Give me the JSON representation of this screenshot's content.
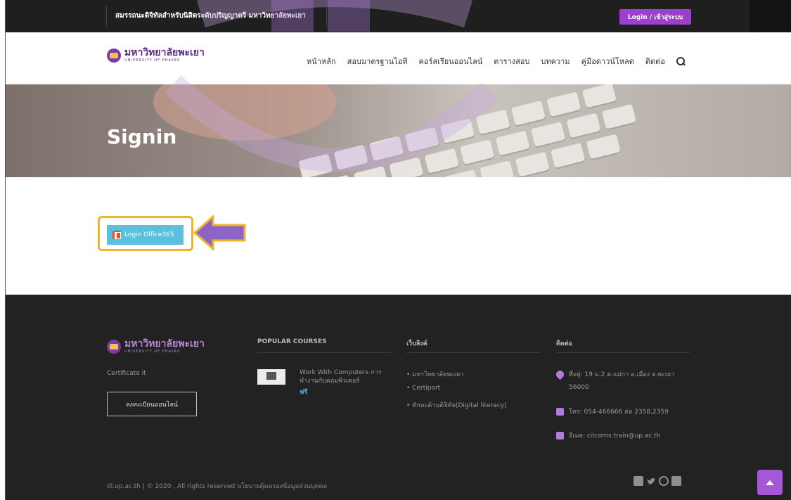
{
  "topbar": {
    "text": "สมรรถนะดิจิทัลสำหรับนิสิตระดับปริญญาตรี มหาวิทยาลัยพะเยา",
    "login_label": "Login / เข้าสู่ระบบ"
  },
  "brand": {
    "name_th": "มหาวิทยาลัยพะเยา",
    "name_en": "UNIVERSITY OF PHAYAO"
  },
  "nav": {
    "items": [
      {
        "label": "หน้าหลัก"
      },
      {
        "label": "สอบมาตรฐานไอที"
      },
      {
        "label": "คอร์สเรียนออนไลน์"
      },
      {
        "label": "ตารางสอบ"
      },
      {
        "label": "บทความ"
      },
      {
        "label": "คู่มือดาวน์โหลด"
      },
      {
        "label": "ติดต่อ"
      }
    ],
    "search_icon": "search-icon"
  },
  "banner": {
    "title": "Signin"
  },
  "content": {
    "office_button_label": "Login Office365",
    "highlight_color": "#f0b429",
    "arrow_color": "#8b64c6"
  },
  "footer": {
    "brand_name_th": "มหาวิทยาลัยพะเยา",
    "brand_name_en": "UNIVERSITY OF PHAYAO",
    "tagline": "Certificate it",
    "register_label": "ลงทะเบียนออนไลน์",
    "popular_title": "POPULAR COURSES",
    "course": {
      "title": "Work With Computers การทำงานกับคอมพิวเตอร์",
      "price": "ฟรี"
    },
    "links_title": "เว็บลิงค์",
    "links": [
      {
        "label": "• มหาวิทยาลัยพะเยา"
      },
      {
        "label": "• Certiport"
      },
      {
        "label": "• ทักษะด้านดิจิทัล(Digital literacy)"
      }
    ],
    "contact_title": "ติดต่อ",
    "contact": {
      "address": "ที่อยู่: 19 ม.2 ต.แม่กา อ.เมือง จ.พะเยา 56000",
      "phone": "โทร: 054-466666 ต่อ 2358,2359",
      "email": "อีเมล: citcoms.train@up.ac.th"
    },
    "copyright": "dl.up.ac.th | © 2020 , All rights reserved นโยบายคุ้มครองข้อมูลส่วนบุคคล",
    "social_icons": [
      "facebook-icon",
      "twitter-icon",
      "instagram-icon",
      "linkedin-icon"
    ]
  },
  "colors": {
    "topbar_bg": "#1f1f1f",
    "accent_purple": "#9b3fcf",
    "office_button_bg": "#5bc0de",
    "footer_bg": "#222222",
    "price_color": "#4fb3d9"
  }
}
